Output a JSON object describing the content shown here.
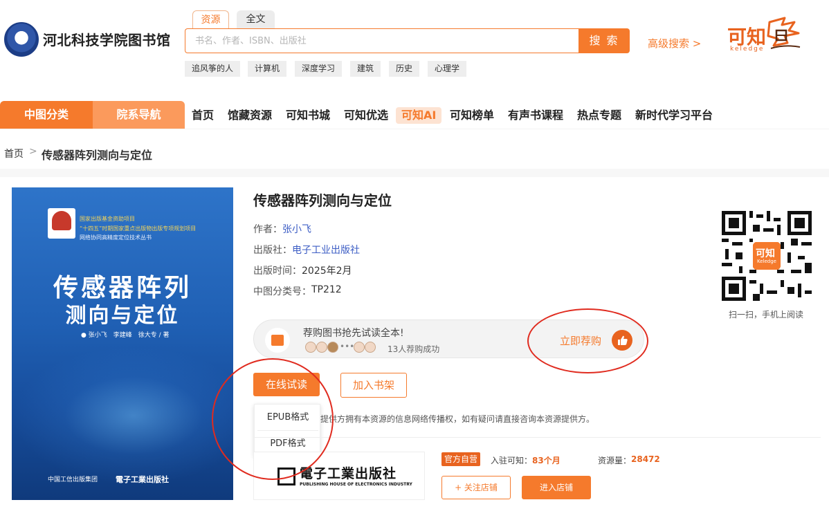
{
  "header": {
    "site_title": "河北科技学院图书馆",
    "search_tabs": [
      "资源",
      "全文"
    ],
    "search_placeholder": "书名、作者、ISBN、出版社",
    "search_button": "搜 索",
    "advanced_search": "高级搜索 >",
    "hot_keywords": [
      "追风筝的人",
      "计算机",
      "深度学习",
      "建筑",
      "历史",
      "心理学"
    ],
    "brand_text": "可知",
    "brand_sub": "keledge"
  },
  "nav": {
    "category": "中图分类",
    "department": "院系导航",
    "items": [
      "首页",
      "馆藏资源",
      "可知书城",
      "可知优选",
      "可知AI",
      "可知榜单",
      "有声书课程",
      "热点专题",
      "新时代学习平台"
    ]
  },
  "breadcrumb": {
    "home": "首页",
    "separator": ">",
    "current": "传感器阵列测向与定位"
  },
  "cover": {
    "line1": "国家出版基金资助项目",
    "line2": "“十四五”时期国家重点出版物出版专项规划项目",
    "line3": "网络协同高精度定位技术丛书",
    "title_line1": "传感器阵列",
    "title_line2": "测向与定位",
    "authors": "● 张小飞　李建峰　徐大专 / 著",
    "publisher_group": "中国工信出版集团",
    "publisher": "電子工業出版社"
  },
  "book": {
    "title": "传感器阵列测向与定位",
    "author_label": "作者：",
    "author": "张小飞",
    "publisher_label": "出版社：",
    "publisher": "电子工业出版社",
    "date_label": "出版时间：",
    "date": "2025年2月",
    "clc_label": "中图分类号：",
    "clc": "TP212"
  },
  "qr": {
    "center_text": "可知",
    "center_sub": "Keledge",
    "caption": "扫一扫，手机上阅读"
  },
  "recommend": {
    "text": "荐购图书抢先试读全本!",
    "dots": "•••",
    "count": "13人荐购成功",
    "button": "立即荐购",
    "thumb_icon": "thumbs-up-icon"
  },
  "actions": {
    "read_online": "在线试读",
    "add_shelf": "加入书架",
    "formats": [
      "EPUB格式",
      "PDF格式"
    ],
    "notice": "提供方拥有本资源的信息网络传播权，如有疑问请直接咨询本资源提供方。"
  },
  "shop": {
    "logo_cn": "電子工業出版社",
    "logo_en": "PUBLISHING HOUSE OF ELECTRONICS INDUSTRY",
    "badge": "官方自营",
    "joined_label": "入驻可知：",
    "joined_value": "83个月",
    "resources_label": "资源量：",
    "resources_value": "28472",
    "follow": "+ 关注店铺",
    "enter": "进入店铺"
  },
  "colors": {
    "accent": "#f57a2c",
    "accent_light": "#fb9a5c",
    "link": "#3b5cc4",
    "annotation_ring": "#e02b1f"
  }
}
